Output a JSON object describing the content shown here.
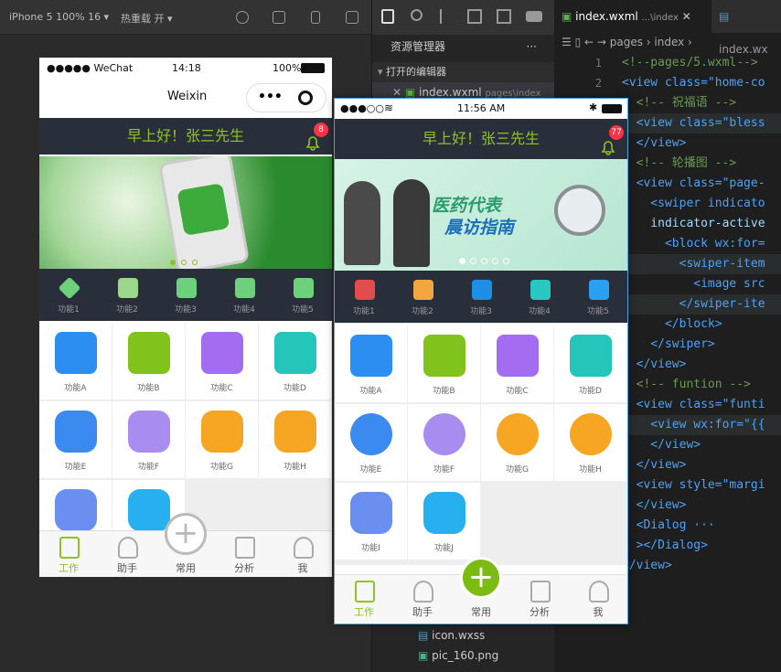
{
  "toolbar": {
    "device": "iPhone 5 100% 16 ▾",
    "hotreload": "热重载 开 ▾"
  },
  "explorer": {
    "title": "资源管理器",
    "more": "···",
    "open_editors": "打开的编辑器",
    "open_file": "index.wxml",
    "open_file_path": "pages\\index",
    "files": [
      "icon.wxss",
      "pic_160.png"
    ]
  },
  "editor": {
    "tabs": [
      {
        "name": "index.wxml",
        "path": "...\\index"
      },
      {
        "name": "index.wx"
      }
    ],
    "breadcrumb": "pages › index ›",
    "lines": [
      {
        "n": "1",
        "text": "<!--pages/5.wxml-->",
        "kind": "c-cm"
      },
      {
        "n": "2",
        "text": "<view class=\"home-co",
        "kind": "c-tg"
      },
      {
        "n": "",
        "text": "  <!-- 祝福语 -->",
        "kind": "c-cm"
      },
      {
        "n": "",
        "text": "  <view class=\"bless",
        "kind": "c-tg"
      },
      {
        "n": "",
        "text": "  </view>",
        "kind": "c-tg"
      },
      {
        "n": "",
        "text": "  <!-- 轮播图 -->",
        "kind": "c-cm"
      },
      {
        "n": "",
        "text": "  <view class=\"page-",
        "kind": "c-tg"
      },
      {
        "n": "",
        "text": "    <swiper indicato",
        "kind": "c-tg"
      },
      {
        "n": "",
        "text": "    indicator-active",
        "kind": "c-at"
      },
      {
        "n": "",
        "text": "      <block wx:for=",
        "kind": "c-tg"
      },
      {
        "n": "",
        "text": "        <swiper-item",
        "kind": "c-tg"
      },
      {
        "n": "",
        "text": "          <image src",
        "kind": "c-tg"
      },
      {
        "n": "",
        "text": "        </swiper-ite",
        "kind": "c-tg"
      },
      {
        "n": "",
        "text": "      </block>",
        "kind": "c-tg"
      },
      {
        "n": "",
        "text": "    </swiper>",
        "kind": "c-tg"
      },
      {
        "n": "",
        "text": "  </view>",
        "kind": "c-tg"
      },
      {
        "n": "",
        "text": "  <!-- funtion -->",
        "kind": "c-cm"
      },
      {
        "n": "",
        "text": "  <view class=\"funti",
        "kind": "c-tg"
      },
      {
        "n": "",
        "text": "    <view wx:for=\"{{",
        "kind": "c-tg"
      },
      {
        "n": "",
        "text": "    </view>",
        "kind": "c-tg"
      },
      {
        "n": "",
        "text": "  </view>",
        "kind": "c-tg"
      },
      {
        "n": "",
        "text": "  <view style=\"margi",
        "kind": "c-tg"
      },
      {
        "n": "",
        "text": "  </view>",
        "kind": "c-tg"
      },
      {
        "n": "",
        "text": "  <Dialog ···",
        "kind": "c-tg"
      },
      {
        "n": "",
        "text": "  ></Dialog>",
        "kind": "c-tg"
      },
      {
        "n": "",
        "text": "</view>",
        "kind": "c-tg"
      }
    ]
  },
  "phone1": {
    "status": {
      "carrier": "●●●●● WeChat",
      "time": "14:18",
      "battery": "100%"
    },
    "nav_title": "Weixin",
    "greeting": "早上好！张三先生",
    "badge": "8",
    "functions": [
      "功能1",
      "功能2",
      "功能3",
      "功能4",
      "功能5"
    ],
    "grid": [
      "功能A",
      "功能B",
      "功能C",
      "功能D",
      "功能E",
      "功能F",
      "功能G",
      "功能H",
      "",
      ""
    ],
    "tabs": [
      "工作",
      "助手",
      "常用",
      "分析",
      "我"
    ]
  },
  "phone2": {
    "status": {
      "carrier": "●●●○○",
      "time": "11:56 AM"
    },
    "greeting": "早上好！张三先生",
    "badge": "77",
    "banner_title": "医药代表",
    "banner_sub": "晨访指南",
    "functions": [
      "功能1",
      "功能2",
      "功能3",
      "功能4",
      "功能5"
    ],
    "grid": [
      "功能A",
      "功能B",
      "功能C",
      "功能D",
      "功能E",
      "功能F",
      "功能G",
      "功能H",
      "功能I",
      "功能J"
    ],
    "tabs": [
      "工作",
      "助手",
      "常用",
      "分析",
      "我"
    ]
  },
  "colors": {
    "accent": "#8fc31f",
    "dark": "#282f3b",
    "badge": "#ff3344"
  }
}
